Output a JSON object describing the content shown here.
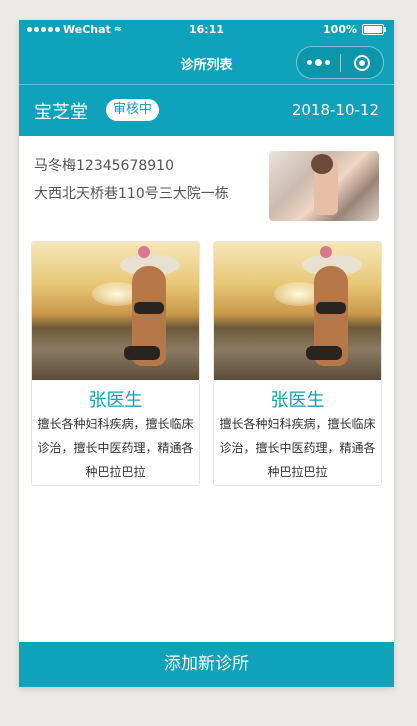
{
  "status_bar": {
    "carrier": "WeChat",
    "time": "16:11",
    "battery": "100%"
  },
  "nav": {
    "title": "诊所列表"
  },
  "clinic": {
    "name": "宝芝堂",
    "status": "审核中",
    "date": "2018-10-12"
  },
  "info": {
    "contact": "马冬梅12345678910",
    "address": "大西北天桥巷110号三大院一栋"
  },
  "doctors": [
    {
      "name": "张医生",
      "description": "擅长各种妇科疾病，擅长临床诊治，擅长中医药理，精通各种巴拉巴拉"
    },
    {
      "name": "张医生",
      "description": "擅长各种妇科疾病，擅长临床诊治，擅长中医药理，精通各种巴拉巴拉"
    }
  ],
  "footer": {
    "add_label": "添加新诊所"
  },
  "colors": {
    "accent": "#0ea3ba",
    "background": "#ebeae6"
  },
  "icons": {
    "more": "more-dots-icon",
    "close": "capsule-close-icon",
    "wifi": "wifi-icon",
    "battery": "battery-icon"
  }
}
